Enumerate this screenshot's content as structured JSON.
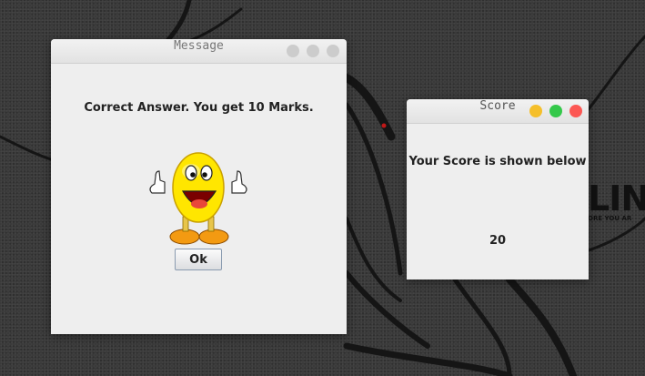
{
  "message_window": {
    "title": "Message",
    "message": "Correct Answer. You get 10 Marks.",
    "ok_label": "Ok",
    "image": "smiley-thumbs-up"
  },
  "score_window": {
    "title": "Score",
    "heading": "Your Score is shown below",
    "score": "20",
    "button_colors": {
      "minimize": "#f5bf2a",
      "maximize": "#34c84a",
      "close": "#fc5753"
    }
  },
  "desktop": {
    "brand_text": "LIN",
    "brand_tagline": "ORE YOU AR"
  }
}
